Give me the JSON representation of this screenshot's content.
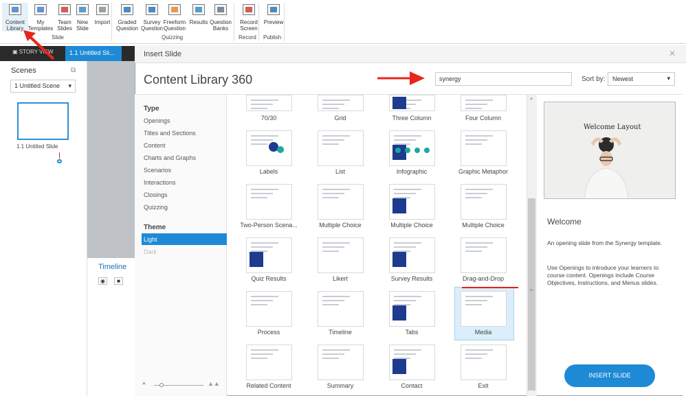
{
  "ribbon": {
    "buttons": [
      {
        "label": "Content\nLibrary",
        "icon": "content-library-icon"
      },
      {
        "label": "My\nTemplates",
        "icon": "templates-icon"
      },
      {
        "label": "Team\nSlides",
        "icon": "team-slides-icon"
      },
      {
        "label": "New\nSlide",
        "icon": "new-slide-icon"
      },
      {
        "label": "Import",
        "icon": "import-icon"
      },
      {
        "label": "Graded\nQuestion",
        "icon": "graded-question-icon"
      },
      {
        "label": "Survey\nQuestion",
        "icon": "survey-question-icon"
      },
      {
        "label": "Freeform\nQuestion",
        "icon": "freeform-question-icon"
      },
      {
        "label": "Results",
        "icon": "results-icon"
      },
      {
        "label": "Question\nBanks",
        "icon": "question-banks-icon"
      },
      {
        "label": "Record\nScreen",
        "icon": "record-screen-icon"
      },
      {
        "label": "Preview",
        "icon": "preview-icon"
      }
    ],
    "groups": {
      "slide": "Slide",
      "quizzing": "Quizzing",
      "record": "Record",
      "publish": "Publish"
    }
  },
  "app": {
    "story_view": "STORY VIEW",
    "active_tab": "1.1 Untitled Sli...",
    "scenes_title": "Scenes",
    "scene_select": "1 Untitled Scene",
    "slide_caption": "1.1 Untitled Slide",
    "timeline_title": "Timeline"
  },
  "dialog": {
    "title": "Insert Slide",
    "library_title": "Content Library 360",
    "search_value": "synergy",
    "sort_label": "Sort by:",
    "sort_value": "Newest",
    "filters": {
      "type_heading": "Type",
      "types": [
        "Openings",
        "Titles and Sections",
        "Content",
        "Charts and Graphs",
        "Scenarios",
        "Interactions",
        "Closings",
        "Quizzing"
      ],
      "theme_heading": "Theme",
      "theme_light": "Light",
      "theme_dark": "Dark"
    },
    "cards": [
      "70/30",
      "Grid",
      "Three Column",
      "Four Column",
      "Labels",
      "List",
      "Infographic",
      "Graphic Metaphor",
      "Two-Person  Scena...",
      "Multiple Choice",
      "Multiple Choice",
      "Multiple Choice",
      "Quiz Results",
      "Likert",
      "Survey Results",
      "Drag-and-Drop",
      "Process",
      "Timeline",
      "Tabs",
      "Media",
      "Related Content",
      "Summary",
      "Contact",
      "Exit"
    ],
    "preview": {
      "image_heading": "Welcome Layout",
      "title": "Welcome",
      "text1": "An opening slide from the Synergy template.",
      "text2": "Use Openings to introduce your learners to course content. Openings include Course Objectives, Instructions, and Menus slides.",
      "insert_button": "INSERT SLIDE"
    }
  },
  "colors": {
    "accent": "#1e8ad6",
    "annotation": "#e8261c"
  }
}
